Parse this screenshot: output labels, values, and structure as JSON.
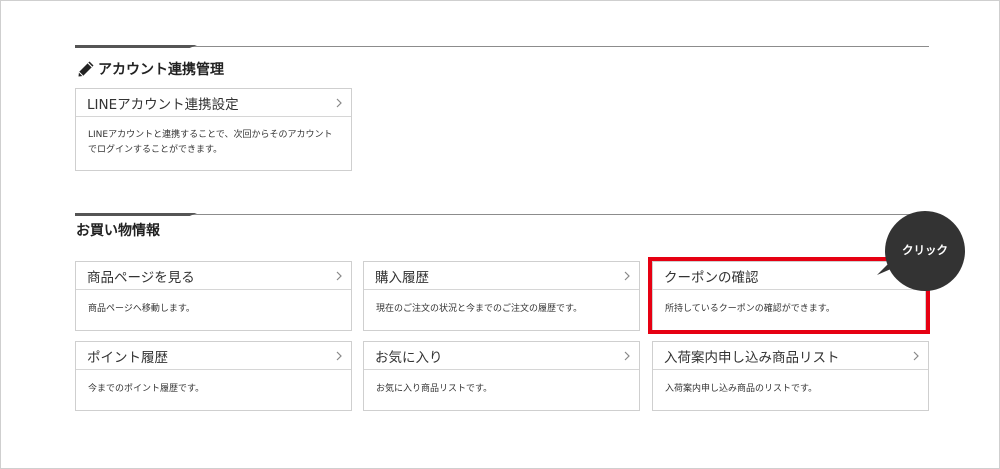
{
  "account_section": {
    "title": "アカウント連携管理",
    "icon": "pencil-icon",
    "cards": [
      {
        "title": "LINEアカウント連携設定",
        "desc_lines": [
          "LINEアカウントと連携することで、次回からそのアカウント",
          "でログインすることができます。"
        ]
      }
    ]
  },
  "shopping_section": {
    "title": "お買い物情報",
    "cards": [
      {
        "title": "商品ページを見る",
        "desc": "商品ページへ移動します。"
      },
      {
        "title": "購入履歴",
        "desc": "現在のご注文の状況と今までのご注文の履歴です。"
      },
      {
        "title": "クーポンの確認",
        "desc": "所持しているクーポンの確認ができます。"
      },
      {
        "title": "ポイント履歴",
        "desc": "今までのポイント履歴です。"
      },
      {
        "title": "お気に入り",
        "desc": "お気に入り商品リストです。"
      },
      {
        "title": "入荷案内申し込み商品リスト",
        "desc": "入荷案内申し込み商品のリストです。"
      }
    ]
  },
  "callout": {
    "label": "クリック",
    "highlight_color": "#e60012",
    "bubble_color": "#333333"
  }
}
